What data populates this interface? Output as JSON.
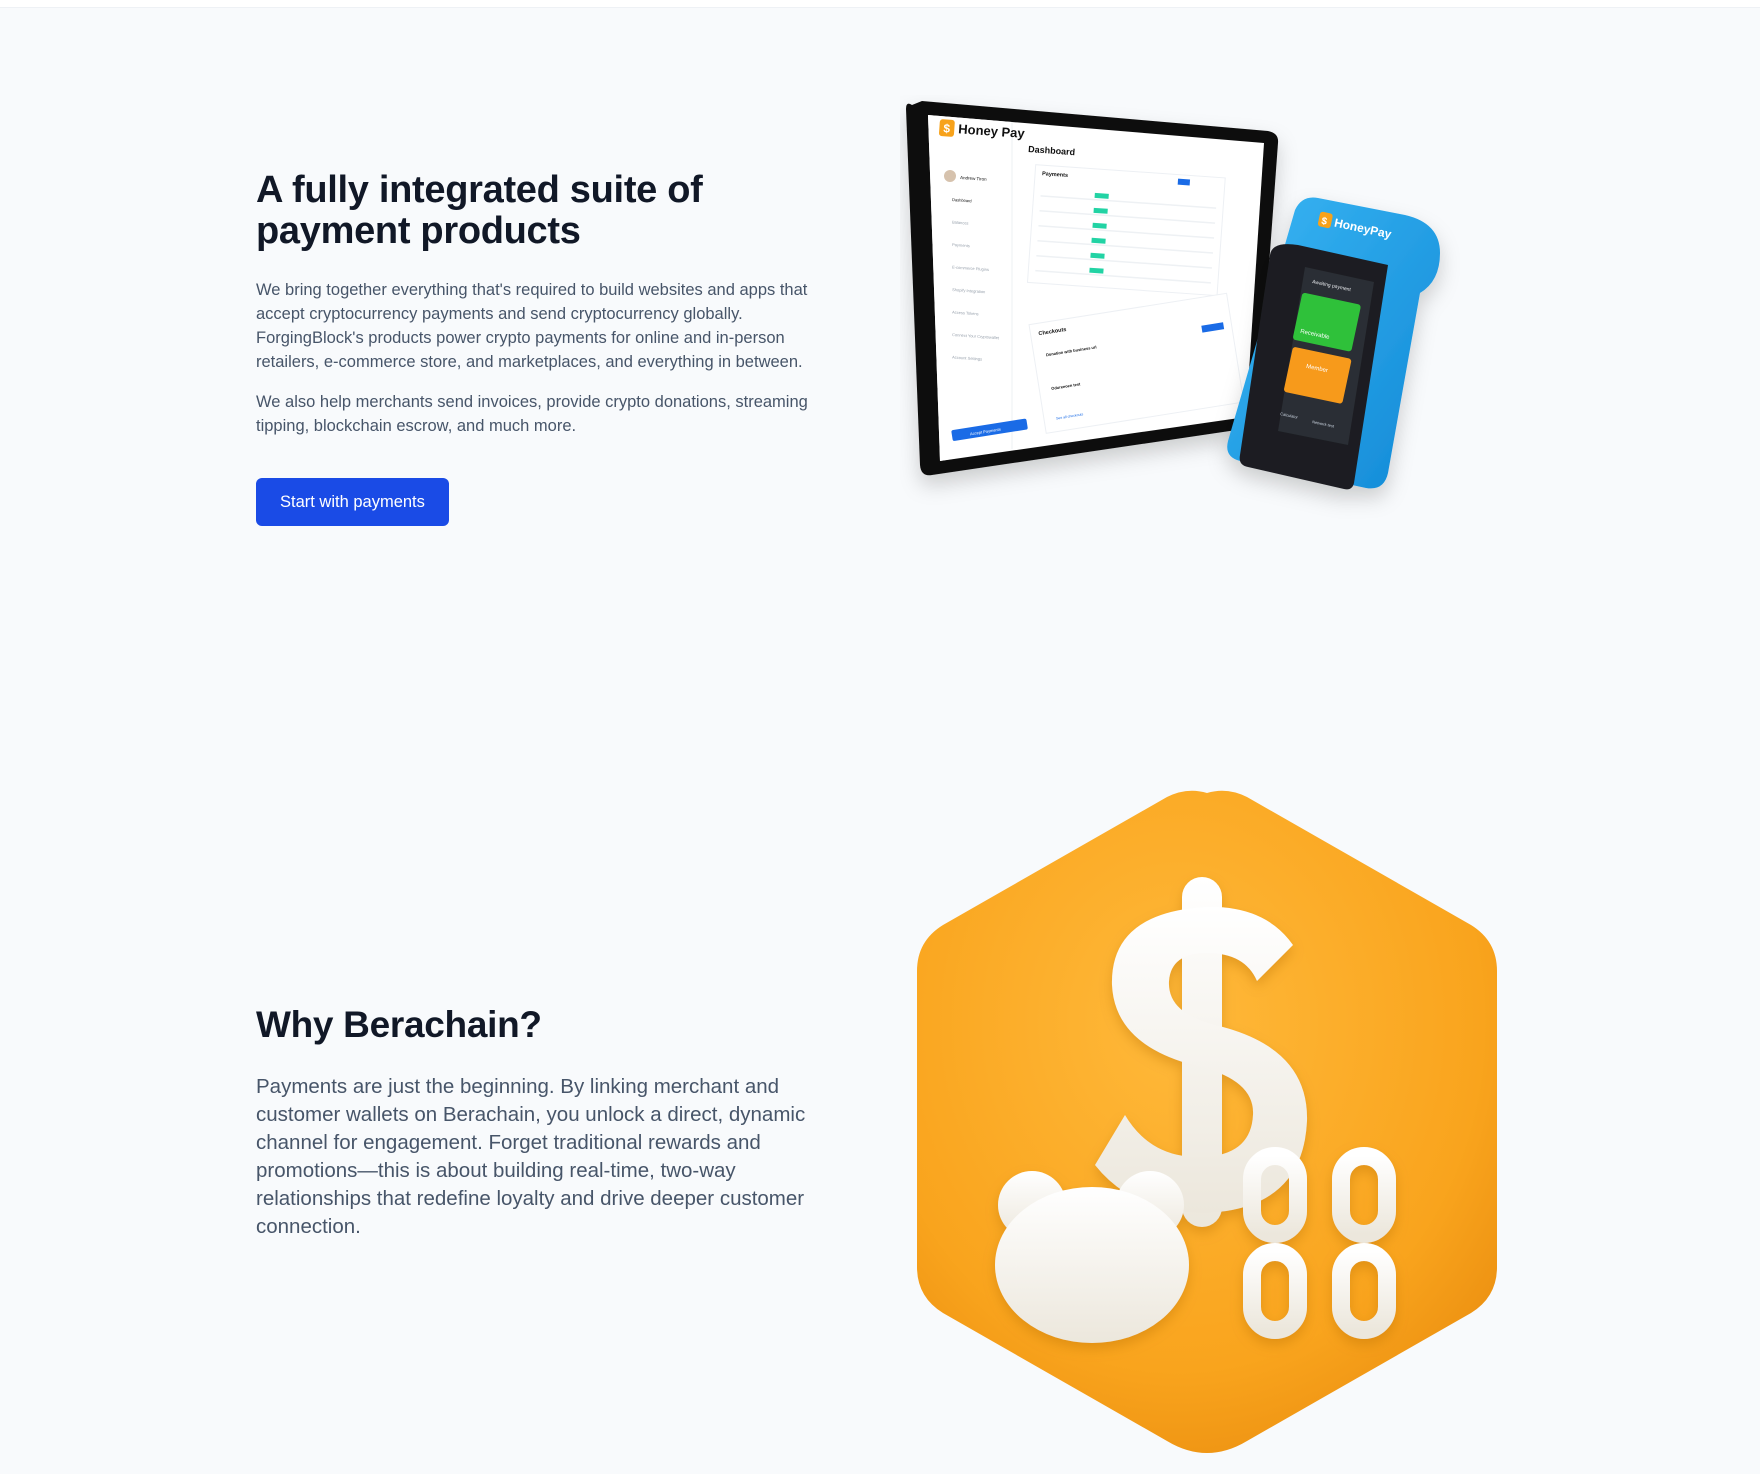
{
  "section_payments": {
    "title": "A fully integrated suite of payment products",
    "paragraph_1": "We bring together everything that's required to build websites and apps that accept cryptocurrency payments and send cryptocurrency globally. ForgingBlock's products power crypto payments for online and in-person retailers, e-commerce store, and marketplaces, and everything in between.",
    "paragraph_2": "We also help merchants send invoices, provide crypto donations, streaming tipping, blockchain escrow, and much more.",
    "cta_label": "Start with payments"
  },
  "devices_illustration": {
    "brand": "Honey Pay",
    "terminal_brand": "HoneyPay",
    "dashboard_title": "Dashboard",
    "user_name": "Andrew Tiron",
    "sidebar_items": [
      "Dashboard",
      "Balances",
      "Payments",
      "E-commerce Plugins",
      "Shopify Integration",
      "Access Tokens",
      "Connect Your Cryptowallet",
      "Account Settings"
    ],
    "payments_heading": "Payments",
    "checkouts_heading": "Checkouts",
    "checkout_items": [
      "Donation with business url",
      "Odureeoen test"
    ],
    "see_all": "See all checkouts",
    "accept_button": "Accept Payments",
    "terminal_status": "Awaiting payment",
    "tile_receivable": "Receivable",
    "tile_member": "Member",
    "terminal_footer": [
      "Calculator",
      "Network test"
    ]
  },
  "section_why": {
    "title": "Why Berachain?",
    "paragraph": "Payments are just the beginning. By linking merchant and customer wallets on Berachain, you unlock a direct, dynamic channel for engagement. Forget traditional rewards and promotions—this is about building real-time, two-way relationships that redefine loyalty and drive deeper customer connection."
  },
  "colors": {
    "background": "#f8fafc",
    "heading": "#111827",
    "body_text": "#475569",
    "cta": "#1a4be6",
    "honey_orange": "#f7a21b",
    "terminal_blue": "#1fa7ec"
  }
}
